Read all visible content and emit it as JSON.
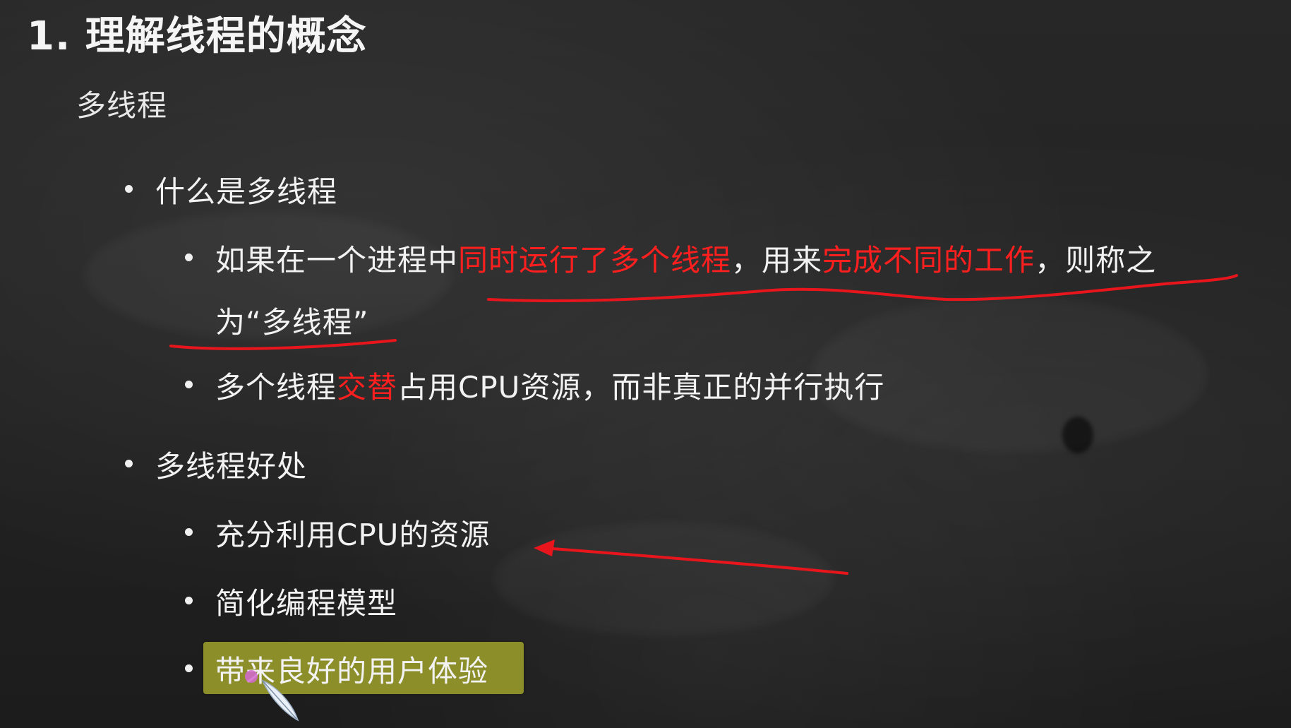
{
  "slide": {
    "title": "1. 理解线程的概念",
    "subtitle": "多线程",
    "sections": [
      {
        "heading": "什么是多线程",
        "items": [
          {
            "line1_a": "如果在一个进程中",
            "line1_b": "同时运行了多个线程",
            "line1_c": "，用来",
            "line1_d": "完成不同的工作",
            "line1_e": "，则称之",
            "line2": "为“多线程”"
          },
          {
            "part_a": "多个线程",
            "part_b": "交替",
            "part_c": "占用CPU资源，而非真正的并行执行"
          }
        ]
      },
      {
        "heading": "多线程好处",
        "items": [
          {
            "text": "充分利用CPU的资源"
          },
          {
            "text": "简化编程模型"
          },
          {
            "text": "带来良好的用户体验"
          }
        ]
      }
    ]
  },
  "colors": {
    "emphasis": "#ff1f1f",
    "annotation": "#e8161c",
    "highlight": "#8c8e2a",
    "text": "#f2f2f2"
  },
  "cursor": {
    "icon": "feather-pen-icon"
  }
}
